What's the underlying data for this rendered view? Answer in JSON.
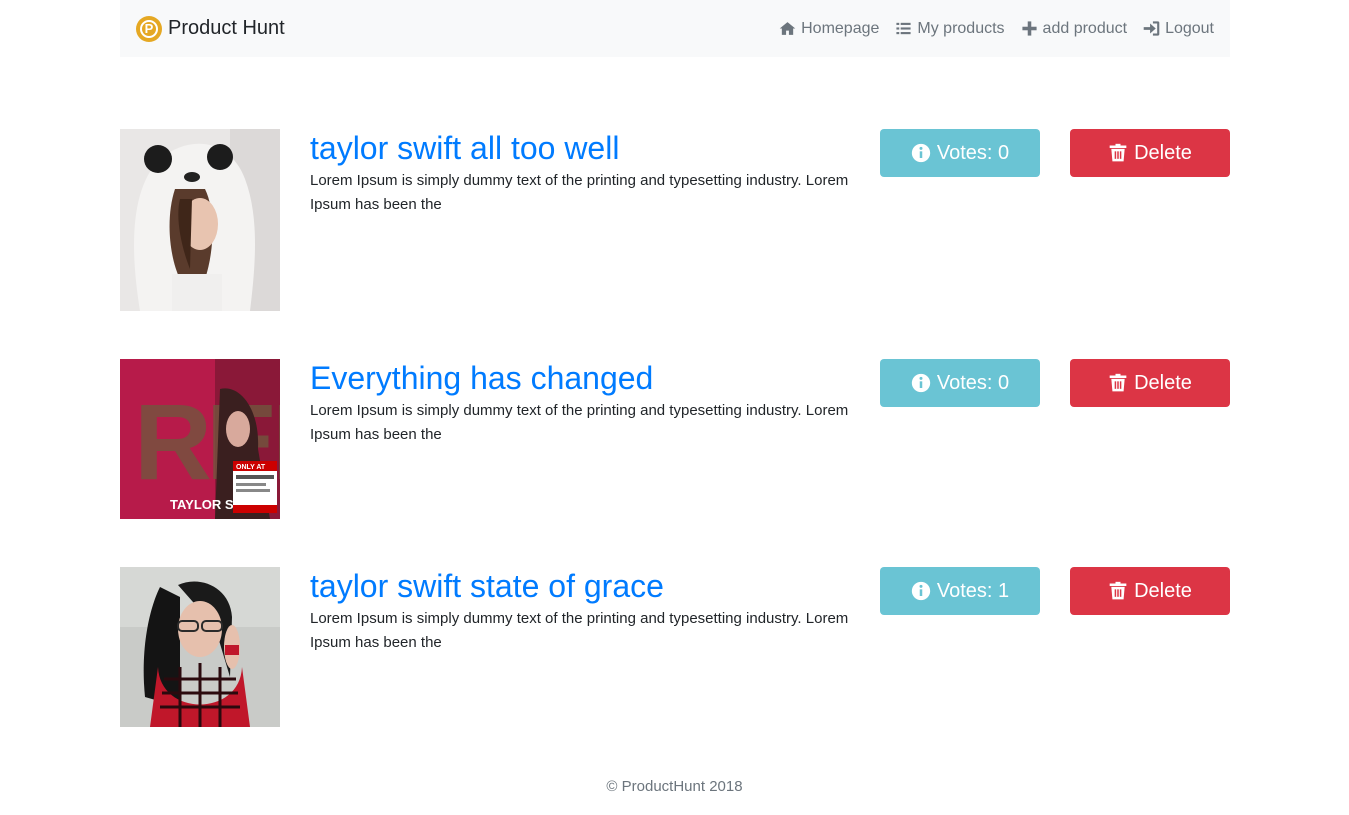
{
  "navbar": {
    "brand_logo_letter": "P",
    "brand_name": "Product Hunt",
    "links": [
      {
        "label": "Homepage",
        "icon": "home-icon"
      },
      {
        "label": "My products",
        "icon": "list-icon"
      },
      {
        "label": "add product",
        "icon": "plus-icon"
      },
      {
        "label": "Logout",
        "icon": "sign-in-icon"
      }
    ]
  },
  "products": [
    {
      "title": "taylor swift all too well",
      "description": "Lorem Ipsum is simply dummy text of the printing and typesetting industry. Lorem Ipsum has been the",
      "votes_label": "Votes: 0",
      "delete_label": "Delete",
      "image": "photo of woman in panda hoodie"
    },
    {
      "title": "Everything has changed",
      "description": "Lorem Ipsum is simply dummy text of the printing and typesetting industry. Lorem Ipsum has been the",
      "votes_label": "Votes: 0",
      "delete_label": "Delete",
      "image": "RED album cover",
      "image_text": {
        "big": "RED",
        "artist": "TAYLOR SWIFT",
        "sticker": "ONLY AT"
      }
    },
    {
      "title": "taylor swift state of grace",
      "description": "Lorem Ipsum is simply dummy text of the printing and typesetting industry. Lorem Ipsum has been the",
      "votes_label": "Votes: 1",
      "delete_label": "Delete",
      "image": "photo of woman with glasses in plaid shirt"
    }
  ],
  "footer": {
    "text": "© ProductHunt 2018"
  },
  "colors": {
    "link": "#007bff",
    "info": "#6ac4d4",
    "danger": "#dc3545",
    "brand": "#e5a823",
    "navbar_bg": "#f8f9fa"
  }
}
